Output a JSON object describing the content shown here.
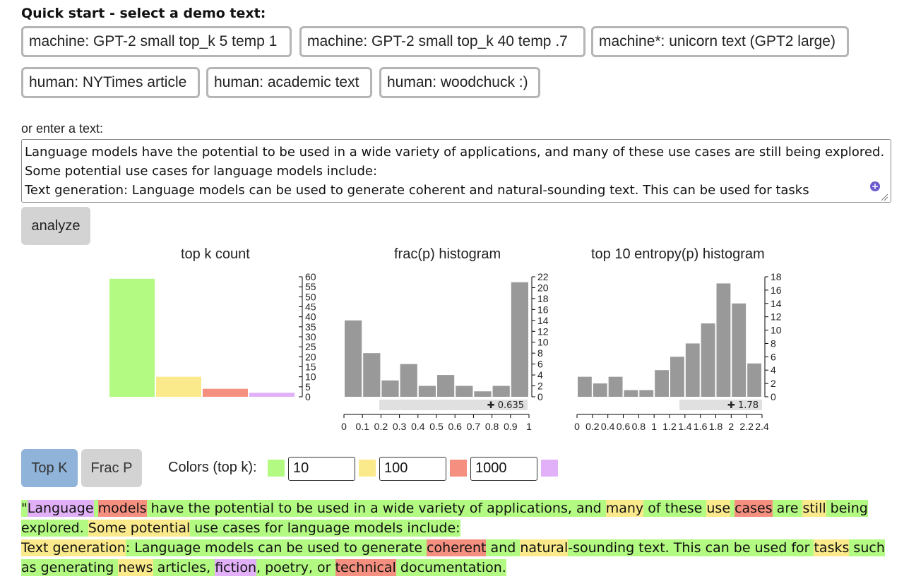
{
  "quick_start": {
    "title": "Quick start - select a demo text:",
    "demos": [
      "machine: GPT-2 small top_k 5 temp 1",
      "machine: GPT-2 small top_k 40 temp .7",
      "machine*: unicorn text (GPT2 large)",
      "human: NYTimes article",
      "human: academic text",
      "human: woodchuck :)"
    ]
  },
  "input": {
    "label": "or enter a text:",
    "value": "Language models have the potential to be used in a wide variety of applications, and many of these use cases are still being explored. Some potential use cases for language models include:\nText generation: Language models can be used to generate coherent and natural-sounding text. This can be used for tasks"
  },
  "analyze_label": "analyze",
  "charts": {
    "topk": {
      "title": "top k count",
      "values": [
        59,
        10,
        4,
        2
      ],
      "colors": [
        "#b2fa81",
        "#fbea8b",
        "#f58f7f",
        "#e1b0f8"
      ],
      "ymax": 60,
      "ticks": [
        "0",
        "5",
        "10",
        "15",
        "20",
        "25",
        "30",
        "35",
        "40",
        "45",
        "50",
        "55",
        "60"
      ]
    },
    "frac": {
      "title": "frac(p) histogram",
      "values": [
        14,
        8,
        3,
        6,
        2,
        4,
        2,
        1,
        2,
        21
      ],
      "ymax": 22,
      "ticks": [
        "0",
        "2",
        "4",
        "6",
        "8",
        "10",
        "12",
        "14",
        "16",
        "18",
        "20",
        "22"
      ],
      "xticks": [
        "0",
        "0.1",
        "0.2",
        "0.3",
        "0.4",
        "0.5",
        "0.6",
        "0.7",
        "0.8",
        "0.9",
        "1"
      ],
      "bar_color": "#999999",
      "median_label": "0.635"
    },
    "entropy": {
      "title": "top 10 entropy(p) histogram",
      "values": [
        3,
        2,
        3,
        1,
        1,
        4,
        6,
        8,
        11,
        17,
        14,
        5
      ],
      "ymax": 18,
      "ticks": [
        "0",
        "2",
        "4",
        "6",
        "8",
        "10",
        "12",
        "14",
        "16",
        "18"
      ],
      "xticks": [
        "0",
        "0.2",
        "0.4",
        "0.6",
        "0.8",
        "1",
        "1.2",
        "1.4",
        "1.6",
        "1.8",
        "2",
        "2.2",
        "2.4"
      ],
      "bar_color": "#999999",
      "median_label": "1.78"
    }
  },
  "mode": {
    "topk_label": "Top K",
    "fracp_label": "Frac P",
    "active_color": "#8fb3d9",
    "inactive_color": "#d3d3d3"
  },
  "colors_legend": {
    "label": "Colors (top k):",
    "swatches": [
      "#b2fa81",
      "#fbea8b",
      "#f58f7f",
      "#e1b0f8"
    ],
    "thresholds": [
      "10",
      "100",
      "1000"
    ]
  },
  "tokens": [
    {
      "t": "\"",
      "c": "green"
    },
    {
      "t": "Language",
      "c": "purple"
    },
    {
      "t": " ",
      "c": "green"
    },
    {
      "t": "models",
      "c": "red"
    },
    {
      "t": " have the potential to be used in a wide variety of applications, and ",
      "c": "green"
    },
    {
      "t": "many",
      "c": "yellow"
    },
    {
      "t": " of these ",
      "c": "green"
    },
    {
      "t": " use",
      "c": "yellow"
    },
    {
      "t": " ",
      "c": "green"
    },
    {
      "t": "cases",
      "c": "red"
    },
    {
      "t": " are ",
      "c": "green"
    },
    {
      "t": "still",
      "c": "yellow"
    },
    {
      "t": " being explored. ",
      "c": "green"
    },
    {
      "t": "Some potential",
      "c": "yellow"
    },
    {
      "t": " use cases for language models include:",
      "c": "green"
    },
    {
      "br": true
    },
    {
      "t": "Text generation",
      "c": "yellow"
    },
    {
      "t": ": Language models can be used to generate ",
      "c": "green"
    },
    {
      "t": "coherent",
      "c": "red"
    },
    {
      "t": " and ",
      "c": "green"
    },
    {
      "t": "natural",
      "c": "yellow"
    },
    {
      "t": "-sounding text. This can be used for ",
      "c": "green"
    },
    {
      "t": "tasks",
      "c": "yellow"
    },
    {
      "t": " such as generating ",
      "c": "green"
    },
    {
      "t": "news",
      "c": "yellow"
    },
    {
      "t": " articles, ",
      "c": "green"
    },
    {
      "t": "fiction",
      "c": "purple"
    },
    {
      "t": ", poetry, or ",
      "c": "green"
    },
    {
      "t": "technical",
      "c": "red"
    },
    {
      "t": " documentation.",
      "c": "green"
    }
  ]
}
